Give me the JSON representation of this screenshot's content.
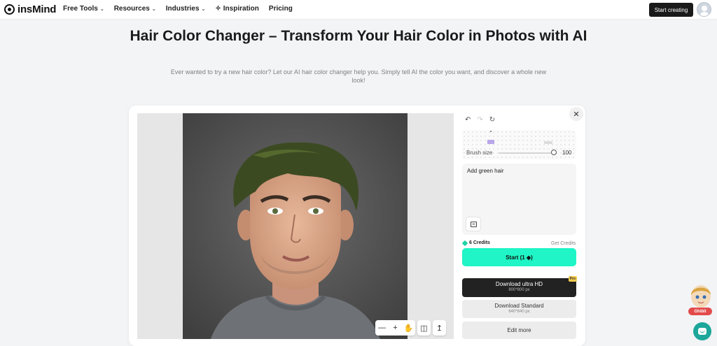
{
  "header": {
    "logo_text": "insMind",
    "nav": [
      {
        "label": "Free Tools",
        "has_dropdown": true
      },
      {
        "label": "Resources",
        "has_dropdown": true
      },
      {
        "label": "Industries",
        "has_dropdown": true
      },
      {
        "label": "Inspiration",
        "icon": "sparkle-icon"
      },
      {
        "label": "Pricing"
      }
    ],
    "cta_label": "Start creating"
  },
  "hero": {
    "title": "Hair Color Changer – Transform Your Hair Color in Photos with AI",
    "subtitle": "Ever wanted to try a new hair color? Let our AI hair color changer help you. Simply tell AI the color you want, and discover a whole new look!"
  },
  "editor": {
    "brush_label": "Brush size",
    "brush_value": "100",
    "brush_level": 1.0,
    "prompt_text": "Add green hair",
    "credits_label": "6 Credits",
    "get_credits_label": "Get Credits",
    "start_label": "Start (1 ◆)",
    "download_ultra": {
      "label": "Download ultra HD",
      "size": "800*800 px",
      "badge": "Pro"
    },
    "download_standard": {
      "label": "Download Standard",
      "size": "640*640 px"
    },
    "edit_more_label": "Edit more"
  },
  "widgets": {
    "ghibli_label": "Ghibli"
  },
  "colors": {
    "accent": "#1ff5c6",
    "dark_button": "#1a1a1a",
    "chat": "#1ca79a"
  }
}
